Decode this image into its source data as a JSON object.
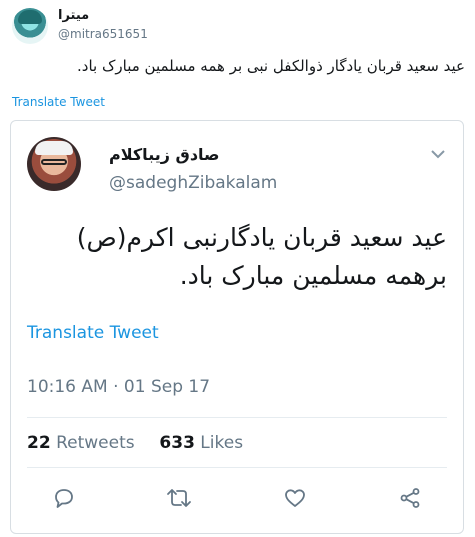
{
  "outer_tweet": {
    "display_name": "میترا",
    "handle": "@mitra651651",
    "text": "عید سعید قربان یادگار ذوالکفل نبی بر همه مسلمین مبارک باد.",
    "translate_label": "Translate Tweet"
  },
  "quoted_tweet": {
    "display_name": "صادق زیباکلام",
    "handle": "@sadeghZibakalam",
    "text": "عید سعید قربان یادگارنبی اکرم(ص) برهمه مسلمین مبارک باد.",
    "translate_label": "Translate Tweet",
    "timestamp": "10:16 AM · 01 Sep 17",
    "stats": {
      "retweets_count": "22",
      "retweets_label": " Retweets",
      "likes_count": "633",
      "likes_label": " Likes"
    }
  },
  "icons": {
    "reply": "reply-icon",
    "retweet": "retweet-icon",
    "like": "heart-icon",
    "share": "share-icon",
    "more": "chevron-down-icon"
  },
  "colors": {
    "link": "#1b95e0",
    "secondary_text": "#657786",
    "border": "#d8dee3"
  }
}
